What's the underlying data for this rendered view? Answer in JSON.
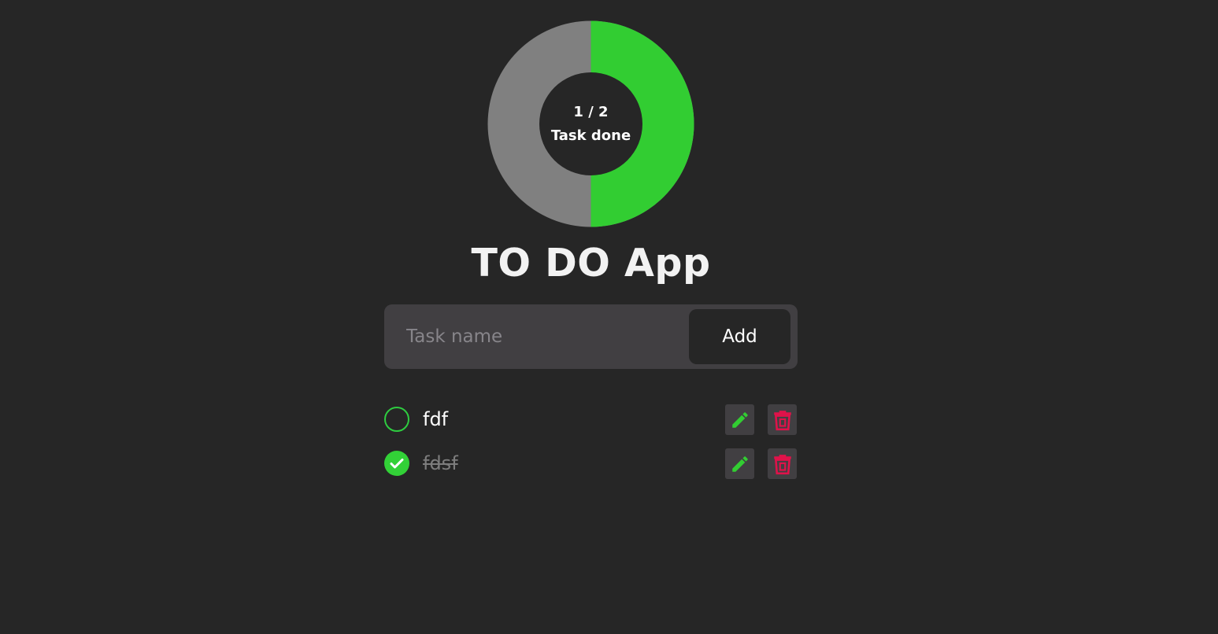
{
  "progress": {
    "done": 1,
    "total": 2,
    "count_label": "1 / 2",
    "caption": "Task done",
    "done_color": "#32cd32",
    "remaining_color": "#808080"
  },
  "app": {
    "title": "TO DO App"
  },
  "add_form": {
    "input_value": "",
    "input_placeholder": "Task name",
    "add_label": "Add"
  },
  "tasks": [
    {
      "name": "fdf",
      "completed": false,
      "edit_icon": "pencil-icon",
      "delete_icon": "trash-icon"
    },
    {
      "name": "fdsf",
      "completed": true,
      "edit_icon": "pencil-icon",
      "delete_icon": "trash-icon"
    }
  ],
  "colors": {
    "background": "#262626",
    "panel": "#413f42",
    "accent_green": "#32cd32",
    "delete_red": "#e0124a"
  }
}
